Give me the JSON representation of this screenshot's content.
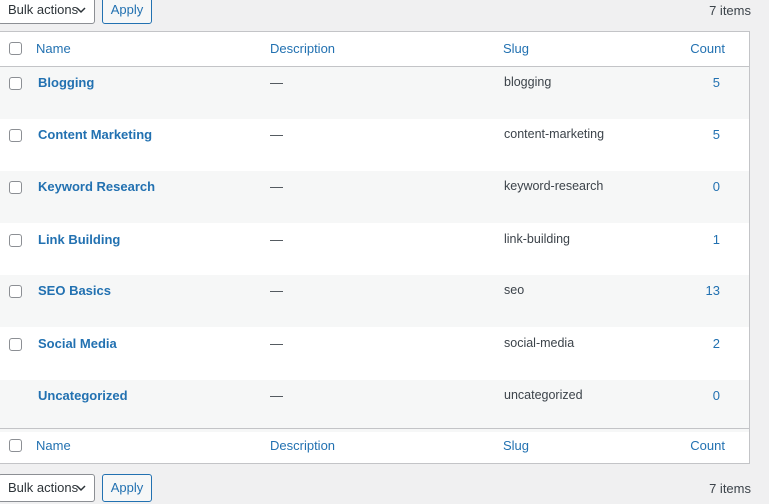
{
  "top_nav": {
    "bulk_actions_label": "Bulk actions",
    "apply_label": "Apply",
    "items_count": "7 items"
  },
  "table": {
    "headers": {
      "name": "Name",
      "description": "Description",
      "slug": "Slug",
      "count": "Count"
    },
    "rows": [
      {
        "name": "Blogging",
        "description": "—",
        "slug": "blogging",
        "count": "5",
        "has_checkbox": true
      },
      {
        "name": "Content Marketing",
        "description": "—",
        "slug": "content-marketing",
        "count": "5",
        "has_checkbox": true
      },
      {
        "name": "Keyword Research",
        "description": "—",
        "slug": "keyword-research",
        "count": "0",
        "has_checkbox": true
      },
      {
        "name": "Link Building",
        "description": "—",
        "slug": "link-building",
        "count": "1",
        "has_checkbox": true
      },
      {
        "name": "SEO Basics",
        "description": "—",
        "slug": "seo",
        "count": "13",
        "has_checkbox": true
      },
      {
        "name": "Social Media",
        "description": "—",
        "slug": "social-media",
        "count": "2",
        "has_checkbox": true
      },
      {
        "name": "Uncategorized",
        "description": "—",
        "slug": "uncategorized",
        "count": "0",
        "has_checkbox": false
      }
    ]
  },
  "bottom_nav": {
    "bulk_actions_label": "Bulk actions",
    "apply_label": "Apply",
    "items_count": "7 items"
  },
  "colors": {
    "link": "#2271b1",
    "text": "#3c434a",
    "border": "#c3c4c7",
    "page_bg": "#f0f0f1",
    "alt_row_bg": "#f6f7f7"
  }
}
